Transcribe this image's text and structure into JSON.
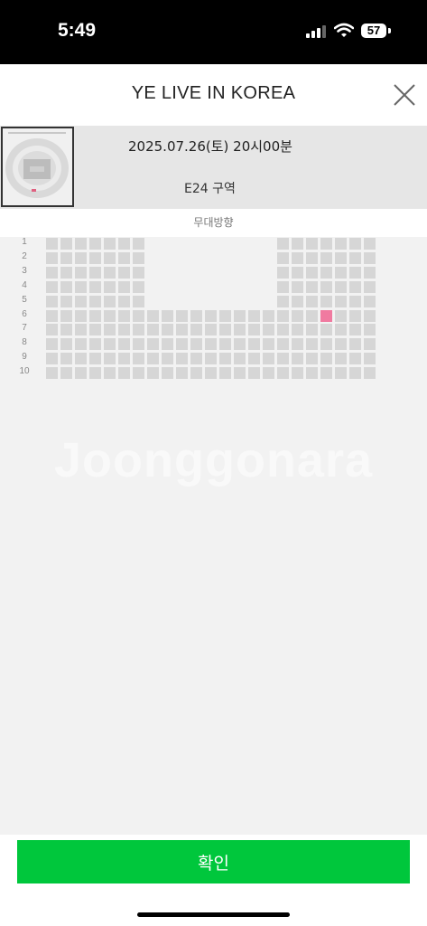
{
  "status_bar": {
    "time": "5:49",
    "battery": "57"
  },
  "header": {
    "title": "YE LIVE IN KOREA"
  },
  "info": {
    "date": "2025.07.26(토) 20시00분",
    "zone": "E24 구역"
  },
  "stage_direction": "무대방향",
  "seat_map": {
    "row_labels": [
      "1",
      "2",
      "3",
      "4",
      "5",
      "6",
      "7",
      "8",
      "9",
      "10"
    ],
    "columns": 23,
    "rows_1_to_5_seat_columns": [
      0,
      1,
      2,
      3,
      4,
      5,
      6,
      16,
      17,
      18,
      19,
      20,
      21,
      22
    ],
    "rows_6_to_10_seat_columns": "all",
    "selected_seat": {
      "row": "6",
      "column": 19
    }
  },
  "watermark": "Joonggonara",
  "footer": {
    "confirm_label": "확인"
  }
}
